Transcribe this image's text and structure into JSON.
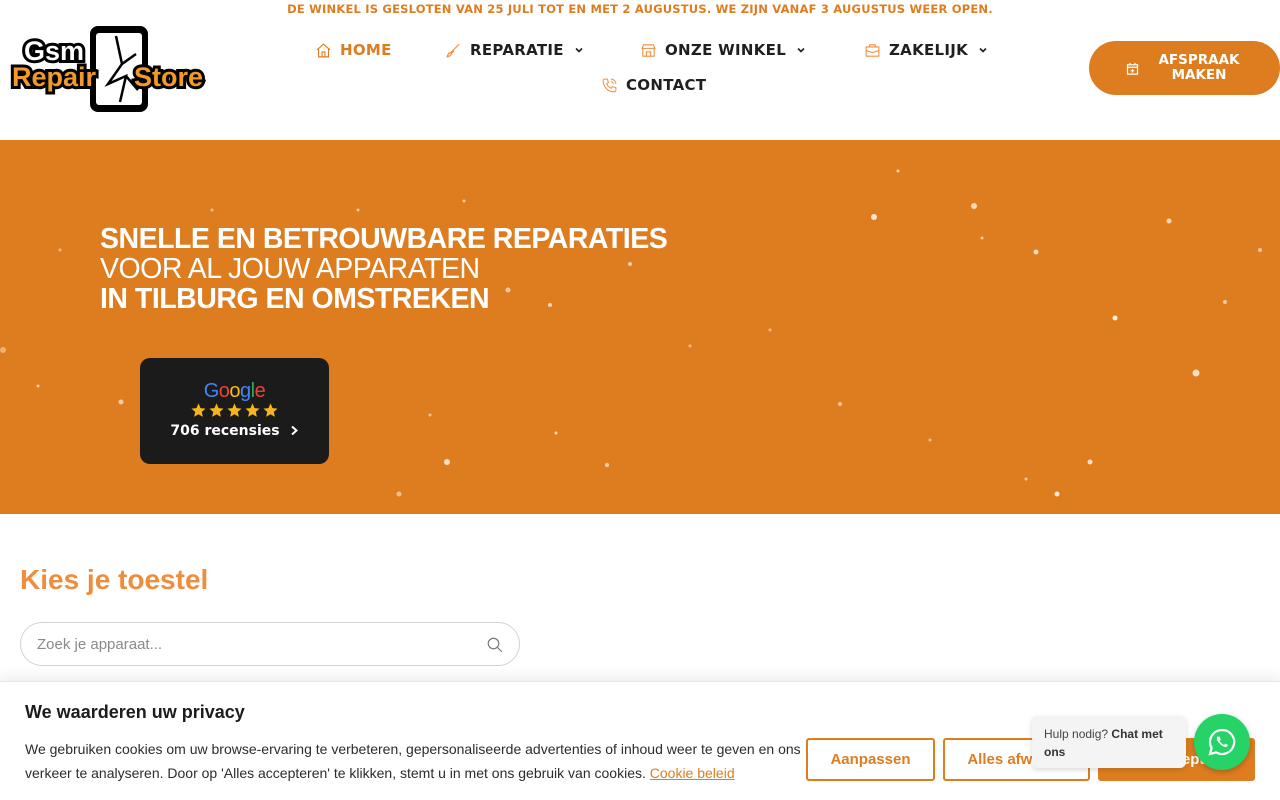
{
  "notice": "DE WINKEL IS GESLOTEN VAN 25 JULI TOT EN MET 2 AUGUSTUS. WE ZIJN VANAF 3 AUGUSTUS WEER OPEN.",
  "logo": {
    "line1": "Gsm",
    "line2": "Repair",
    "line3": "Store"
  },
  "nav": {
    "home": "HOME",
    "reparatie": "REPARATIE",
    "winkel": "ONZE WINKEL",
    "zakelijk": "ZAKELIJK",
    "contact": "CONTACT"
  },
  "cta": {
    "label": "AFSPRAAK MAKEN"
  },
  "hero": {
    "line1": "SNELLE EN BETROUWBARE REPARATIES",
    "line2": "VOOR AL JOUW APPARATEN",
    "line3": "IN TILBURG EN OMSTREKEN"
  },
  "review": {
    "brand": [
      "G",
      "o",
      "o",
      "g",
      "l",
      "e"
    ],
    "rating": 5,
    "count": "706 recensies"
  },
  "device": {
    "title": "Kies je toestel",
    "placeholder": "Zoek je apparaat..."
  },
  "cookie": {
    "title": "We waarderen uw privacy",
    "text": "We gebruiken cookies om uw browse-ervaring te verbeteren, gepersonaliseerde advertenties of inhoud weer te geven en ons verkeer te analyseren. Door op 'Alles accepteren' te klikken, stemt u in met ons gebruik van cookies.",
    "link": "Cookie beleid",
    "customize": "Aanpassen",
    "reject": "Alles afwijzen",
    "accept": "Alles accepteren"
  },
  "chat": {
    "text": "Hulp nodig?",
    "bold": "Chat met ons"
  },
  "colors": {
    "accent": "#dd7d20",
    "heading": "#ef8d3f",
    "whatsapp": "#25d366",
    "star": "#f7b51b"
  },
  "icons": [
    "home-icon",
    "brush-icon",
    "store-icon",
    "briefcase-icon",
    "phone-icon",
    "calendar-plus-icon",
    "search-icon",
    "whatsapp-icon",
    "chevron-right-icon",
    "chevron-down-icon",
    "star-icon"
  ]
}
